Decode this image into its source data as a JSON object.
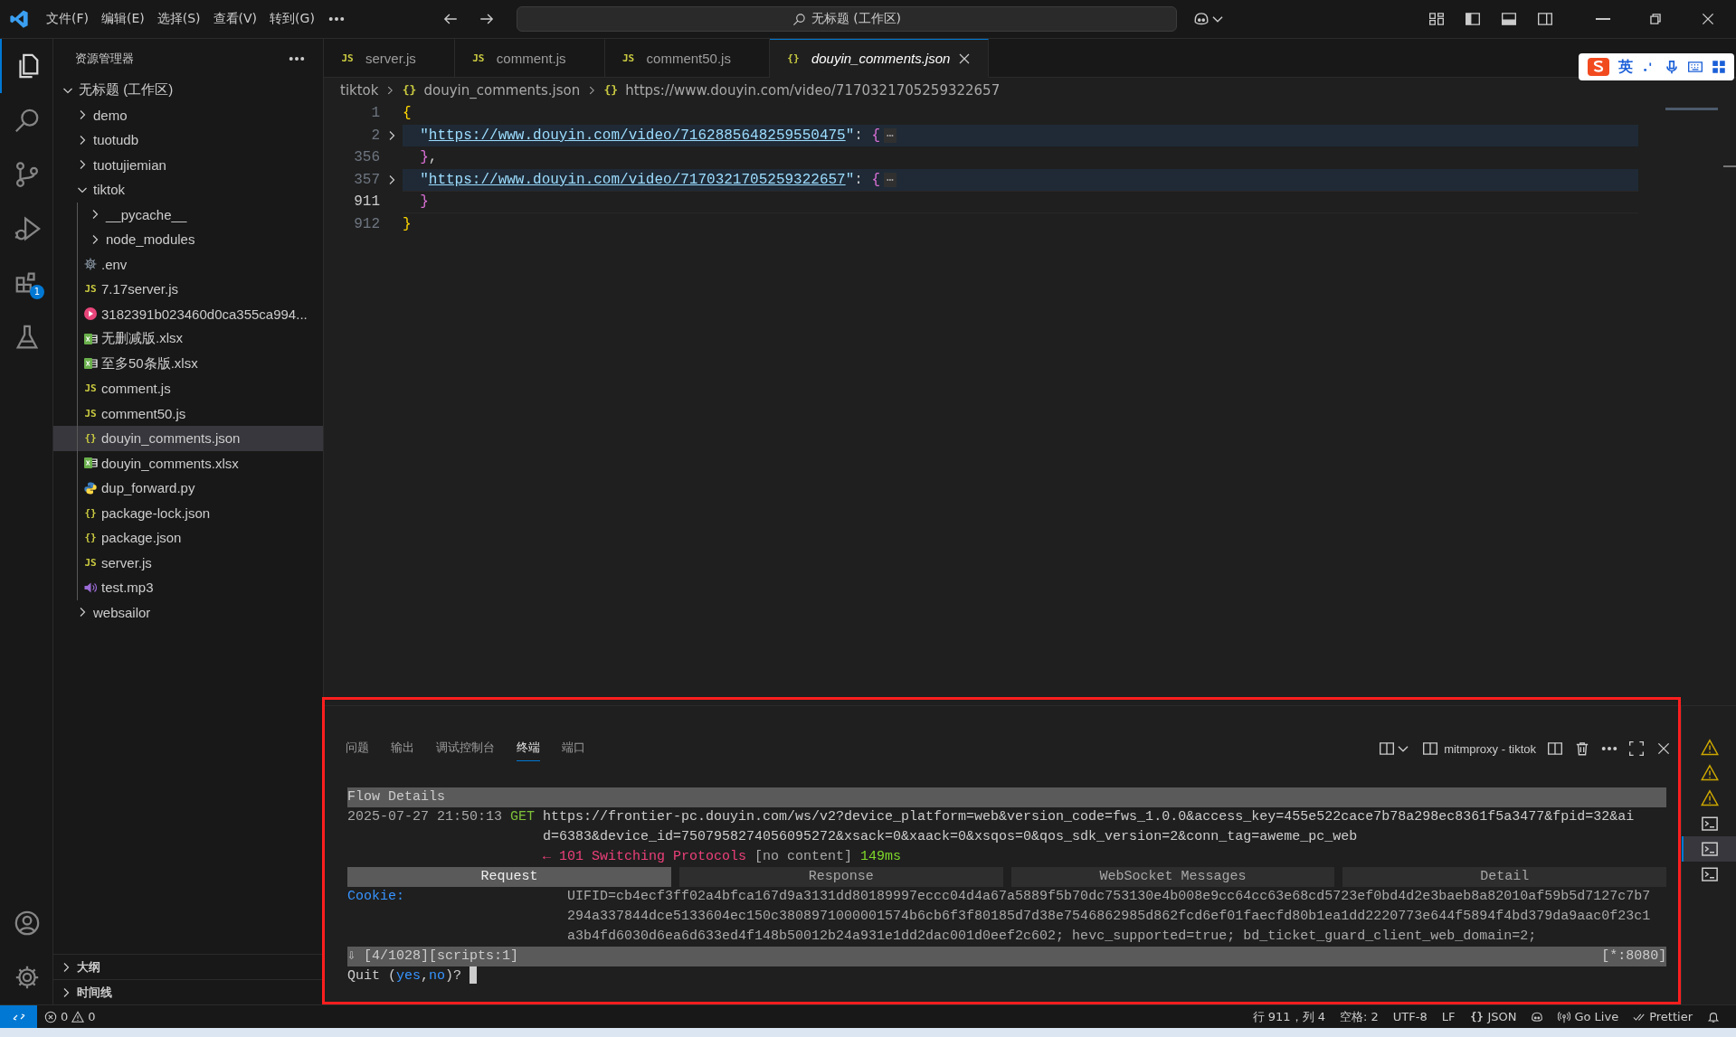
{
  "title_bar": {
    "menus": [
      "文件(F)",
      "编辑(E)",
      "选择(S)",
      "查看(V)",
      "转到(G)"
    ],
    "search_label": "无标题 (工作区)"
  },
  "ime_toolbar": {
    "mode": "英"
  },
  "activity_bar": {
    "items": [
      {
        "selected": true
      },
      {
        "selected": false
      },
      {
        "selected": false
      },
      {
        "selected": false
      },
      {
        "selected": false,
        "badge": "1"
      },
      {
        "selected": false
      }
    ]
  },
  "sidebar": {
    "title": "资源管理器",
    "tree": [
      {
        "label": "无标题 (工作区)",
        "kind": "root",
        "expanded": true,
        "selected": false,
        "children": [
          {
            "label": "demo",
            "kind": "folder",
            "expanded": false,
            "selected": false
          },
          {
            "label": "tuotudb",
            "kind": "folder",
            "expanded": false,
            "selected": false
          },
          {
            "label": "tuotujiemian",
            "kind": "folder",
            "expanded": false,
            "selected": false
          },
          {
            "label": "tiktok",
            "kind": "folder",
            "expanded": true,
            "selected": false,
            "children": [
              {
                "label": "__pycache__",
                "kind": "folder",
                "expanded": false,
                "selected": false
              },
              {
                "label": "node_modules",
                "kind": "folder",
                "expanded": false,
                "selected": false
              },
              {
                "label": ".env",
                "kind": "settings-file",
                "selected": false
              },
              {
                "label": "7.17server.js",
                "kind": "js-file",
                "icon_label": "JS",
                "selected": false
              },
              {
                "label": "3182391b023460d0ca355ca994...",
                "kind": "media-file",
                "selected": false
              },
              {
                "label": "无删减版.xlsx",
                "kind": "excel-file",
                "selected": false
              },
              {
                "label": "至多50条版.xlsx",
                "kind": "excel-file",
                "selected": false
              },
              {
                "label": "comment.js",
                "kind": "js-file",
                "icon_label": "JS",
                "selected": false
              },
              {
                "label": "comment50.js",
                "kind": "js-file",
                "icon_label": "JS",
                "selected": false
              },
              {
                "label": "douyin_comments.json",
                "kind": "json-file",
                "icon_label": "{}",
                "selected": true
              },
              {
                "label": "douyin_comments.xlsx",
                "kind": "excel-file",
                "selected": false
              },
              {
                "label": "dup_forward.py",
                "kind": "python-file",
                "selected": false
              },
              {
                "label": "package-lock.json",
                "kind": "json-file",
                "icon_label": "{}",
                "selected": false
              },
              {
                "label": "package.json",
                "kind": "json-file",
                "icon_label": "{}",
                "selected": false
              },
              {
                "label": "server.js",
                "kind": "js-file",
                "icon_label": "JS",
                "selected": false
              },
              {
                "label": "test.mp3",
                "kind": "audio-file",
                "selected": false
              }
            ]
          },
          {
            "label": "websailor",
            "kind": "folder",
            "expanded": false,
            "selected": false
          }
        ]
      }
    ],
    "sections": [
      {
        "label": "大纲",
        "expanded": false
      },
      {
        "label": "时间线",
        "expanded": false
      }
    ]
  },
  "tabs": [
    {
      "label": "server.js",
      "icon_label": "JS",
      "selected": false,
      "preview": false
    },
    {
      "label": "comment.js",
      "icon_label": "JS",
      "selected": false,
      "preview": false
    },
    {
      "label": "comment50.js",
      "icon_label": "JS",
      "selected": false,
      "preview": false
    },
    {
      "label": "douyin_comments.json",
      "icon_label": "{}",
      "selected": true,
      "preview": true
    }
  ],
  "breadcrumbs": [
    {
      "label": "tiktok",
      "kind": "folder"
    },
    {
      "label": "douyin_comments.json",
      "kind": "file",
      "icon_label": "{}"
    },
    {
      "label": "https://www.douyin.com/video/7170321705259322657",
      "kind": "symbol",
      "icon_label": "{}"
    }
  ],
  "editor": {
    "lines": [
      {
        "number": "1",
        "folded": false,
        "highlight": false,
        "current": false,
        "tokens": [
          {
            "text": "{",
            "kind": "brace1"
          }
        ]
      },
      {
        "number": "2",
        "folded": true,
        "highlight": true,
        "current": false,
        "tokens": [
          {
            "text": "  \"",
            "kind": "key"
          },
          {
            "text": "https://www.douyin.com/video/7162885648259550475",
            "kind": "link"
          },
          {
            "text": "\"",
            "kind": "key"
          },
          {
            "text": ": ",
            "kind": "punct"
          },
          {
            "text": "{",
            "kind": "brace2"
          },
          {
            "text": "⋯",
            "kind": "ellipsis"
          }
        ]
      },
      {
        "number": "356",
        "folded": false,
        "highlight": false,
        "current": false,
        "tokens": [
          {
            "text": "  }",
            "kind": "brace2"
          },
          {
            "text": ",",
            "kind": "punct"
          }
        ]
      },
      {
        "number": "357",
        "folded": true,
        "highlight": true,
        "current": false,
        "tokens": [
          {
            "text": "  \"",
            "kind": "key"
          },
          {
            "text": "https://www.douyin.com/video/7170321705259322657",
            "kind": "link"
          },
          {
            "text": "\"",
            "kind": "key"
          },
          {
            "text": ": ",
            "kind": "punct"
          },
          {
            "text": "{",
            "kind": "brace2"
          },
          {
            "text": "⋯",
            "kind": "ellipsis"
          }
        ]
      },
      {
        "number": "911",
        "folded": false,
        "highlight": false,
        "current": true,
        "tokens": [
          {
            "text": "  }",
            "kind": "brace2"
          }
        ]
      },
      {
        "number": "912",
        "folded": false,
        "highlight": false,
        "current": false,
        "tokens": [
          {
            "text": "}",
            "kind": "brace1"
          }
        ]
      }
    ]
  },
  "panel": {
    "highlighted": true,
    "tabs": [
      {
        "label": "问题",
        "selected": false
      },
      {
        "label": "输出",
        "selected": false
      },
      {
        "label": "调试控制台",
        "selected": false
      },
      {
        "label": "终端",
        "selected": true
      },
      {
        "label": "端口",
        "selected": false
      }
    ],
    "terminal_name": "mitmproxy - tiktok",
    "terminal": {
      "header": "Flow Details",
      "timestamp": "2025-07-27 21:50:13",
      "method": "GET",
      "url": "https://frontier-pc.douyin.com/ws/v2?device_platform=web&version_code=fws_1.0.0&access_key=455e522cace7b78a298ec8361f5a3477&fpid=32&aid=6383&device_id=7507958274056095272&xsack=0&xaack=0&xsqos=0&qos_sdk_version=2&conn_tag=aweme_pc_web",
      "response": [
        {
          "text": "← 101 Switching Protocols",
          "kind": "status"
        },
        {
          "text": " [no content] ",
          "kind": "plain"
        },
        {
          "text": "149ms",
          "kind": "time"
        }
      ],
      "detail_tabs": [
        {
          "label": "Request",
          "selected": true
        },
        {
          "label": "Response",
          "selected": false
        },
        {
          "label": "WebSocket Messages",
          "selected": false
        },
        {
          "label": "Detail",
          "selected": false
        }
      ],
      "headers": [
        {
          "name": "Cookie:",
          "value": "UIFID=cb4ecf3ff02a4bfca167d9a3131dd80189997eccc04d4a67a5889f5b70dc753130e4b008e9cc64cc63e68cd5723ef0bd4d2e3baeb8a82010af59b5d7127c7b7294a337844dce5133604ec150c3808971000001574b6cb6f3f80185d7d38e7546862985d862fcd6ef01faecfd80b1ea1dd2220773e644f5894f4bd379da9aac0f23c1a3b4fd6030d6ea6d633ed4f148b50012b24a931e1dd2dac001d0eef2c602; hevc_supported=true; bd_ticket_guard_client_web_domain=2;"
        }
      ],
      "status_left": "⇩ [4/1028][scripts:1]",
      "status_right": "[*:8080]",
      "prompt": [
        {
          "text": "Quit (",
          "kind": "plain"
        },
        {
          "text": "yes",
          "kind": "option"
        },
        {
          "text": ",",
          "kind": "plain"
        },
        {
          "text": "no",
          "kind": "option"
        },
        {
          "text": ")? ",
          "kind": "plain"
        }
      ]
    },
    "terminal_list": [
      {
        "kind": "warning",
        "selected": false
      },
      {
        "kind": "warning",
        "selected": false
      },
      {
        "kind": "warning",
        "selected": false
      },
      {
        "kind": "terminal",
        "selected": false
      },
      {
        "kind": "terminal",
        "selected": true
      },
      {
        "kind": "terminal",
        "selected": false
      }
    ]
  },
  "status_bar": {
    "errors": "0",
    "warnings": "0",
    "items": [
      {
        "kind": "text",
        "label": "行 911，列 4"
      },
      {
        "kind": "text",
        "label": "空格: 2"
      },
      {
        "kind": "text",
        "label": "UTF-8"
      },
      {
        "kind": "text",
        "label": "LF"
      },
      {
        "kind": "language",
        "icon_label": "{}",
        "label": "JSON"
      },
      {
        "kind": "copilot"
      },
      {
        "kind": "live",
        "label": "Go Live"
      },
      {
        "kind": "prettier",
        "label": "Prettier"
      },
      {
        "kind": "bell"
      }
    ]
  }
}
